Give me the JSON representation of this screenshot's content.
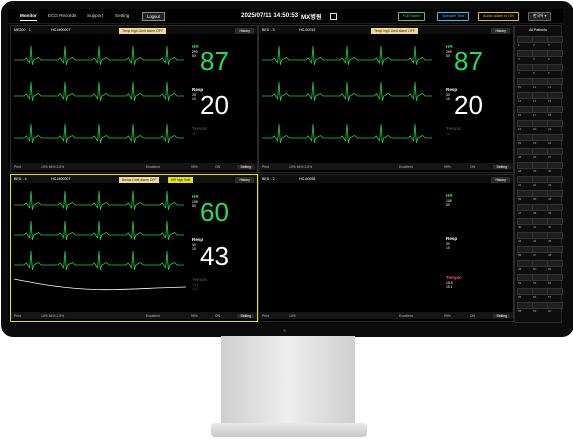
{
  "topbar": {
    "tabs": [
      "Monitor",
      "ECG Records",
      "Support",
      "Setting"
    ],
    "logout": "Logout",
    "datetime": "2025/07/11 14:50:53",
    "clock_suffix": "MX병원",
    "full_name_btn": "Full Name",
    "speaker_btn": "Speaker Test",
    "alarm_btn": "Audio alarm is ON",
    "lang": "한국어"
  },
  "beds": [
    {
      "bed": "ME200 - 1",
      "hc": "HC-M00007",
      "name": "",
      "alarm": "Temp high Limit alarm OFF",
      "alarm_color": "#f2d98d",
      "hr_label": "HR",
      "hr": "87",
      "hr_hi": "299",
      "hr_lo": "50",
      "resp_label": "Resp",
      "resp": "20",
      "resp_hi": "30",
      "resp_lo": "10",
      "temp_label": "Temp/c",
      "temp_hi": "25",
      "history": "History",
      "bottom": [
        "Print",
        "10% 84% 2.5%",
        "Excellent",
        "99%",
        "ON",
        "Setting"
      ]
    },
    {
      "bed": "BED - 3",
      "hc": "HC-00019",
      "name": "",
      "alarm": "Temp high Limit alarm OFF",
      "alarm_color": "#f2d98d",
      "hr_label": "HR",
      "hr": "87",
      "hr_hi": "299",
      "hr_lo": "50",
      "resp_label": "Resp",
      "resp": "20",
      "resp_hi": "30",
      "resp_lo": "10",
      "temp_label": "Temp/c",
      "temp_hi": "25",
      "history": "History",
      "bottom": [
        "Print",
        "10% 84% 2.5%",
        "Excellent",
        "99%",
        "ON",
        "Setting"
      ]
    },
    {
      "bed": "BED - 4",
      "hc": "HC-M00007",
      "name": "",
      "alarm": "Below Limit alarm OFF",
      "alarm_color": "#f2d98d",
      "hr_label": "HR",
      "hr": "60",
      "hr_hi": "108",
      "hr_lo": "50",
      "hr_alarm": "HR high limit",
      "resp_label": "Resp",
      "resp": "43",
      "resp_hi": "30",
      "resp_lo": "10",
      "temp_label": "Temp/c",
      "temp_hi": "15.5",
      "temp_lo": "15.1",
      "history": "History",
      "bottom": [
        "Print",
        "10% 84% 2.5%",
        "Excellent",
        "99%",
        "ON",
        "Setting"
      ]
    },
    {
      "bed": "BED - 2",
      "hc": "HC-60098",
      "name": "",
      "alarm": "",
      "alarm_color": "#000000",
      "hr_label": "HR",
      "hr": "",
      "hr_hi": "108",
      "hr_lo": "50",
      "resp_label": "Resp",
      "resp": "",
      "resp_hi": "30",
      "resp_lo": "10",
      "temp_label": "Temp/c",
      "temp_hi": "15.5",
      "temp_lo": "15.1",
      "history": "History",
      "bottom": [
        "Print",
        "10%",
        "Excellent",
        "99%",
        "ON",
        "Setting"
      ]
    }
  ],
  "sidebar": {
    "title": "All Patients",
    "numbers": [
      "1",
      "2",
      "3",
      "4",
      "5",
      "6",
      "7",
      "8",
      "9",
      "10",
      "11",
      "12",
      "13",
      "14",
      "15",
      "16",
      "17",
      "18",
      "19",
      "20",
      "21",
      "22",
      "23",
      "24",
      "25",
      "26",
      "27",
      "28",
      "29",
      "30",
      "31",
      "32",
      "33",
      "34",
      "35",
      "36",
      "37",
      "38",
      "39",
      "40",
      "41",
      "42",
      "43",
      "44",
      "45",
      "46",
      "47",
      "48",
      "49",
      "50",
      "51",
      "52",
      "53",
      "54",
      "55",
      "56",
      "57",
      "58",
      "59",
      "60"
    ]
  },
  "colors": {
    "ecg": "#22d13f",
    "hr": "#22e05a",
    "resp": "#ffffff",
    "temp": "#ff4a6a",
    "yellow": "#e6e600",
    "cyan_pill": "#23c4ff",
    "green_pill": "#57c74f",
    "yellow_pill": "#e6c200"
  }
}
